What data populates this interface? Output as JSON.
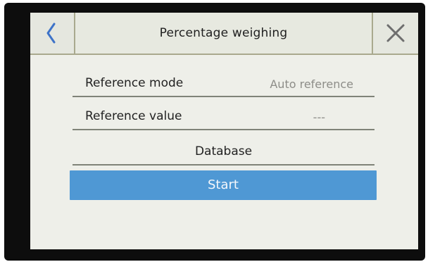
{
  "header": {
    "title": "Percentage weighing",
    "back_icon": "chevron-left-icon",
    "close_icon": "close-icon"
  },
  "settings": {
    "reference_mode": {
      "label": "Reference mode",
      "value": "Auto reference"
    },
    "reference_value": {
      "label": "Reference value",
      "value": "---"
    },
    "database": {
      "label": "Database"
    }
  },
  "actions": {
    "start_label": "Start"
  },
  "colors": {
    "accent": "#4f98d4",
    "icon_blue": "#3e73c8",
    "screen_bg": "#eeefe9"
  }
}
